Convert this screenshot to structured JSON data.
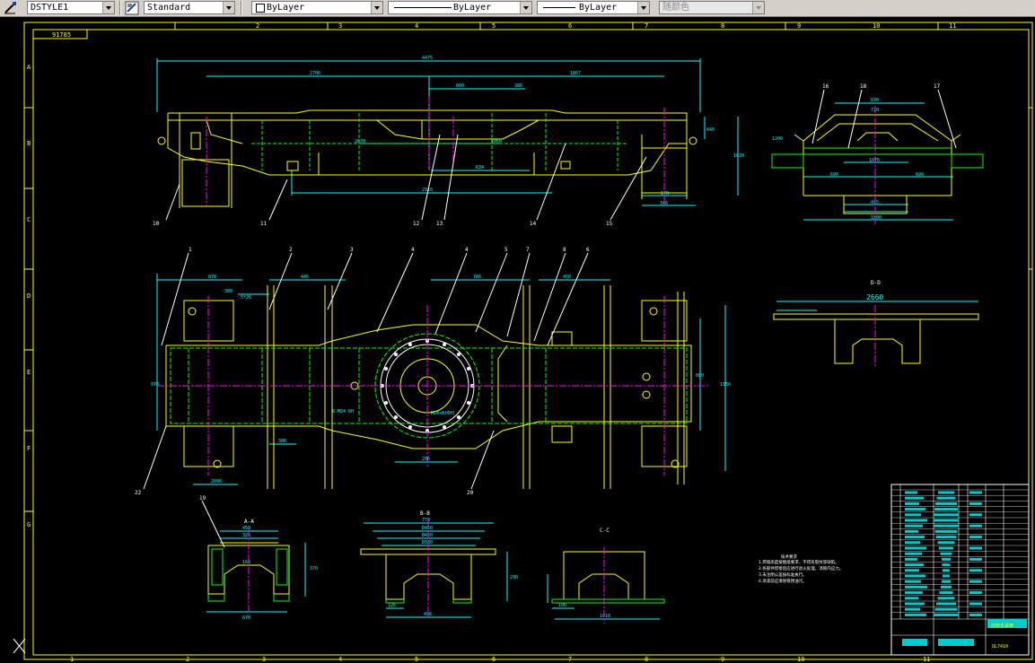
{
  "toolbar": {
    "dimstyle": "DSTYLE1",
    "textstyle": "Standard",
    "layer": "ByLayer",
    "linetype": "ByLayer",
    "lineweight": "ByLayer",
    "plotstyle": "随颜色"
  },
  "drawing": {
    "grid_top": [
      "2",
      "3",
      "4",
      "5",
      "6",
      "7",
      "8",
      "9",
      "10",
      "11"
    ],
    "grid_bottom": [
      "1",
      "2",
      "3",
      "4",
      "5",
      "6",
      "7",
      "8",
      "9",
      "10",
      "11"
    ],
    "grid_side": [
      "A",
      "B",
      "C",
      "D",
      "E",
      "F",
      "G"
    ],
    "title_tag": "91785",
    "section_a": "A-A",
    "section_b": "B-B",
    "section_c": "C-C",
    "section_d": "D-D",
    "dim_2660": "2660",
    "callouts": [
      "1",
      "2",
      "3",
      "4",
      "4",
      "5",
      "7",
      "8",
      "6",
      "10",
      "11",
      "12",
      "13",
      "14",
      "15",
      "16",
      "17",
      "18",
      "19",
      "20",
      "22"
    ],
    "notes_title": "技术要求",
    "notes": [
      "1.焊缝高度按图纸要求，不得有裂纹等缺陷。",
      "2.各部件焊接后应进行退火处理，消除内应力。",
      "3.未注明公差按标准执行。",
      "4.涂漆前应清除铁锈油污。"
    ],
    "title_block_name": "前桥支承架",
    "title_block_code": "QL7410"
  }
}
